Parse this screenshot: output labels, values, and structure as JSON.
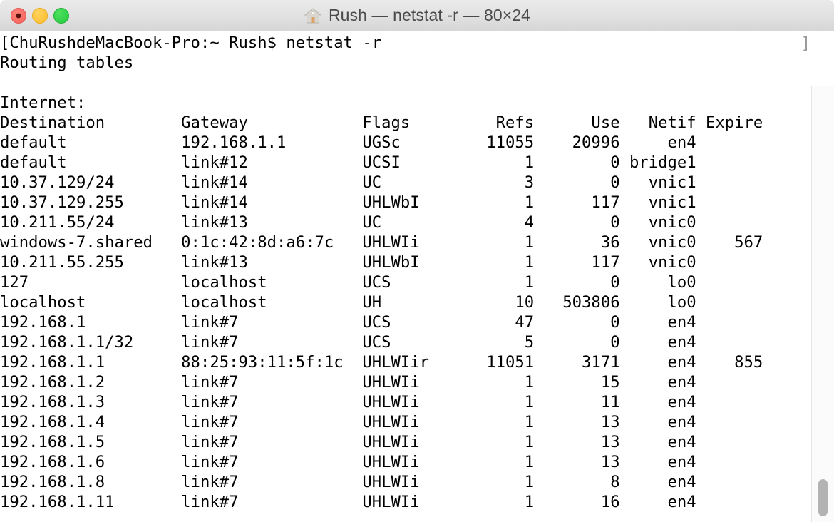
{
  "window": {
    "title": "Rush — netstat -r — 80×24",
    "home_icon": "home-icon",
    "traffic_lights": {
      "close": "close-button",
      "minimize": "minimize-button",
      "maximize": "maximize-button"
    },
    "split_pane_button": "split-pane-button"
  },
  "terminal": {
    "prompt_line": "[ChuRushdeMacBook-Pro:~ Rush$ netstat -r",
    "prompt_wrap_char": "]",
    "heading": "Routing tables",
    "blank": "",
    "section": "Internet:",
    "columns": [
      "Destination",
      "Gateway",
      "Flags",
      "Refs",
      "Use",
      "Netif",
      "Expire"
    ],
    "header_line": "Destination        Gateway            Flags        Refs      Use   Netif Expire",
    "rows": [
      {
        "destination": "default",
        "gateway": "192.168.1.1",
        "flags": "UGSc",
        "refs": "11055",
        "use": "20996",
        "netif": "en4",
        "expire": ""
      },
      {
        "destination": "default",
        "gateway": "link#12",
        "flags": "UCSI",
        "refs": "1",
        "use": "0",
        "netif": "bridge1",
        "expire": ""
      },
      {
        "destination": "10.37.129/24",
        "gateway": "link#14",
        "flags": "UC",
        "refs": "3",
        "use": "0",
        "netif": "vnic1",
        "expire": ""
      },
      {
        "destination": "10.37.129.255",
        "gateway": "link#14",
        "flags": "UHLWbI",
        "refs": "1",
        "use": "117",
        "netif": "vnic1",
        "expire": ""
      },
      {
        "destination": "10.211.55/24",
        "gateway": "link#13",
        "flags": "UC",
        "refs": "4",
        "use": "0",
        "netif": "vnic0",
        "expire": ""
      },
      {
        "destination": "windows-7.shared",
        "gateway": "0:1c:42:8d:a6:7c",
        "flags": "UHLWIi",
        "refs": "1",
        "use": "36",
        "netif": "vnic0",
        "expire": "567"
      },
      {
        "destination": "10.211.55.255",
        "gateway": "link#13",
        "flags": "UHLWbI",
        "refs": "1",
        "use": "117",
        "netif": "vnic0",
        "expire": ""
      },
      {
        "destination": "127",
        "gateway": "localhost",
        "flags": "UCS",
        "refs": "1",
        "use": "0",
        "netif": "lo0",
        "expire": ""
      },
      {
        "destination": "localhost",
        "gateway": "localhost",
        "flags": "UH",
        "refs": "10",
        "use": "503806",
        "netif": "lo0",
        "expire": ""
      },
      {
        "destination": "192.168.1",
        "gateway": "link#7",
        "flags": "UCS",
        "refs": "47",
        "use": "0",
        "netif": "en4",
        "expire": ""
      },
      {
        "destination": "192.168.1.1/32",
        "gateway": "link#7",
        "flags": "UCS",
        "refs": "5",
        "use": "0",
        "netif": "en4",
        "expire": ""
      },
      {
        "destination": "192.168.1.1",
        "gateway": "88:25:93:11:5f:1c",
        "flags": "UHLWIir",
        "refs": "11051",
        "use": "3171",
        "netif": "en4",
        "expire": "855"
      },
      {
        "destination": "192.168.1.2",
        "gateway": "link#7",
        "flags": "UHLWIi",
        "refs": "1",
        "use": "15",
        "netif": "en4",
        "expire": ""
      },
      {
        "destination": "192.168.1.3",
        "gateway": "link#7",
        "flags": "UHLWIi",
        "refs": "1",
        "use": "11",
        "netif": "en4",
        "expire": ""
      },
      {
        "destination": "192.168.1.4",
        "gateway": "link#7",
        "flags": "UHLWIi",
        "refs": "1",
        "use": "13",
        "netif": "en4",
        "expire": ""
      },
      {
        "destination": "192.168.1.5",
        "gateway": "link#7",
        "flags": "UHLWIi",
        "refs": "1",
        "use": "13",
        "netif": "en4",
        "expire": ""
      },
      {
        "destination": "192.168.1.6",
        "gateway": "link#7",
        "flags": "UHLWIi",
        "refs": "1",
        "use": "13",
        "netif": "en4",
        "expire": ""
      },
      {
        "destination": "192.168.1.8",
        "gateway": "link#7",
        "flags": "UHLWIi",
        "refs": "1",
        "use": "8",
        "netif": "en4",
        "expire": ""
      },
      {
        "destination": "192.168.1.11",
        "gateway": "link#7",
        "flags": "UHLWIi",
        "refs": "1",
        "use": "16",
        "netif": "en4",
        "expire": ""
      }
    ]
  },
  "colors": {
    "titlebar_top": "#eaeaea",
    "titlebar_bottom": "#d6d6d6",
    "terminal_bg": "#ffffff",
    "terminal_fg": "#000000",
    "close": "#f4635a",
    "minimize": "#febc2e",
    "maximize": "#27c93f",
    "scrollbar_thumb": "#b3b3b3"
  }
}
